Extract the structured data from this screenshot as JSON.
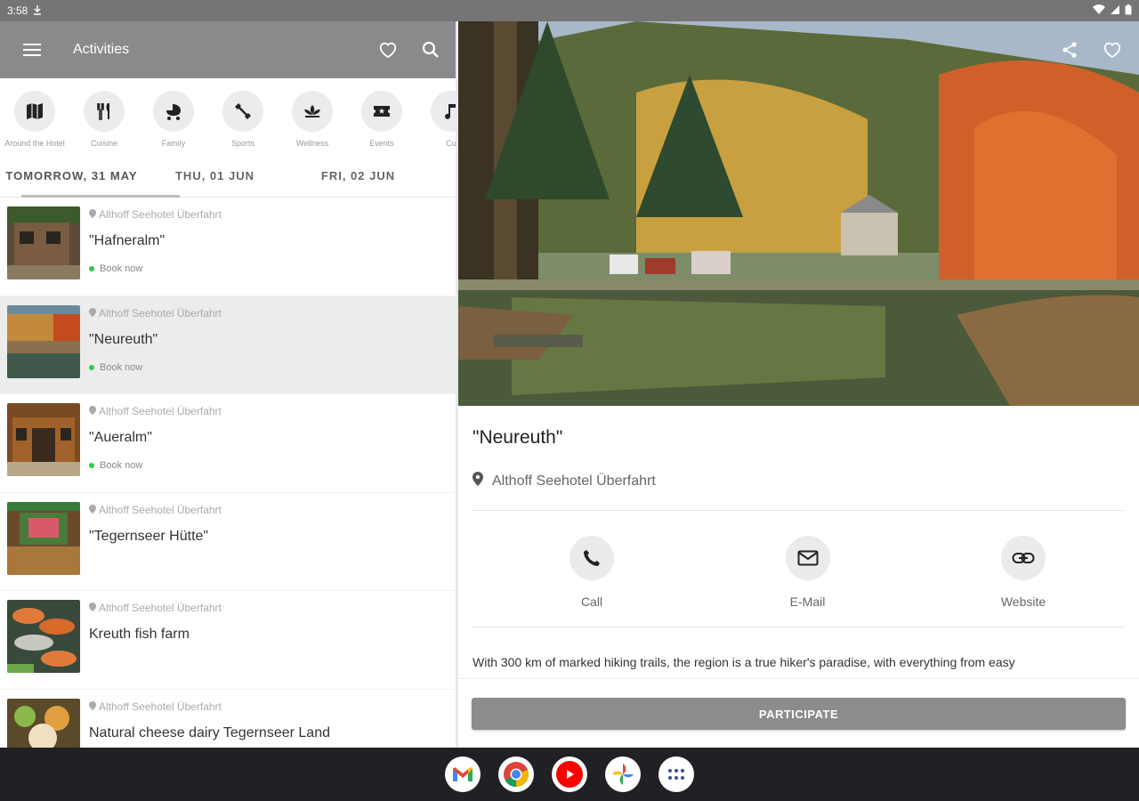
{
  "status": {
    "time": "3:58"
  },
  "appbar": {
    "title": "Activities"
  },
  "categories": [
    {
      "label": "Around the Hotel",
      "icon": "map-icon"
    },
    {
      "label": "Cuisine",
      "icon": "cutlery-icon"
    },
    {
      "label": "Family",
      "icon": "stroller-icon"
    },
    {
      "label": "Sports",
      "icon": "dumbbell-icon"
    },
    {
      "label": "Wellness",
      "icon": "lotus-icon"
    },
    {
      "label": "Events",
      "icon": "ticket-icon"
    },
    {
      "label": "Cu",
      "icon": "music-icon"
    }
  ],
  "date_tabs": [
    "TOMORROW, 31 MAY",
    "THU, 01 JUN",
    "FRI, 02 JUN"
  ],
  "list": [
    {
      "location": "Althoff Seehotel Überfahrt",
      "name": "\"Hafneralm\"",
      "book": "Book now"
    },
    {
      "location": "Althoff Seehotel Überfahrt",
      "name": "\"Neureuth\"",
      "book": "Book now"
    },
    {
      "location": "Althoff Seehotel Überfahrt",
      "name": "\"Aueralm\"",
      "book": "Book now"
    },
    {
      "location": "Althoff Seehotel Überfahrt",
      "name": "\"Tegernseer Hütte\"",
      "book": ""
    },
    {
      "location": "Althoff Seehotel Überfahrt",
      "name": "Kreuth fish farm",
      "book": ""
    },
    {
      "location": "Althoff Seehotel Überfahrt",
      "name": "Natural cheese dairy Tegernseer Land",
      "book": ""
    }
  ],
  "detail": {
    "title": "\"Neureuth\"",
    "location": "Althoff Seehotel Überfahrt",
    "contacts": [
      "Call",
      "E-Mail",
      "Website"
    ],
    "description": "With 300 km of marked hiking trails, the region is a true hiker's paradise, with everything from easy",
    "participate": "PARTICIPATE"
  },
  "colors": {
    "appbar": "#8a8a8a",
    "book_dot": "#2ecc40",
    "button": "#8c8c8c"
  }
}
